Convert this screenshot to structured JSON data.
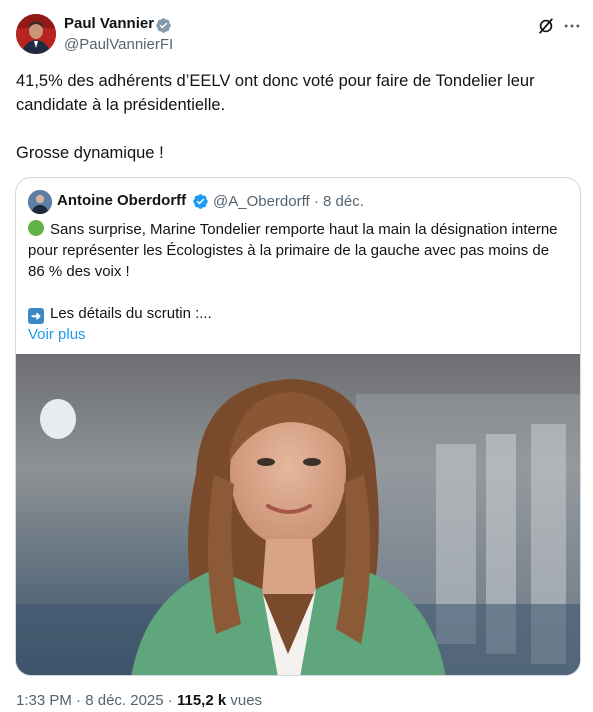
{
  "author": {
    "name": "Paul Vannier",
    "handle": "@PaulVannierFI",
    "verified": true
  },
  "tweet": {
    "text": "41,5% des adhérents d’EELV ont donc voté pour faire de Tondelier leur candidate à la présidentielle.\n\nGrosse dynamique !"
  },
  "quoted": {
    "author_name": "Antoine Oberdorff",
    "handle": "@A_Oberdorff",
    "separator": "·",
    "date": "8 déc.",
    "line1": "Sans surprise, Marine Tondelier remporte haut la main la désignation interne pour représenter les Écologistes à la primaire de la gauche avec pas moins de 86 % des voix !",
    "line2": "Les détails du scrutin :...",
    "see_more": "Voir plus",
    "emoji_1": "green-circle-icon",
    "emoji_2": "right-arrow-icon"
  },
  "footer": {
    "time": "1:33 PM",
    "sep": "·",
    "date": "8 déc. 2025",
    "views_count": "115,2 k",
    "views_label": "vues"
  },
  "colors": {
    "text": "#0f1419",
    "secondary": "#536471",
    "link": "#1d9bf0",
    "verified": "#829aab",
    "border": "#cfd9de"
  }
}
